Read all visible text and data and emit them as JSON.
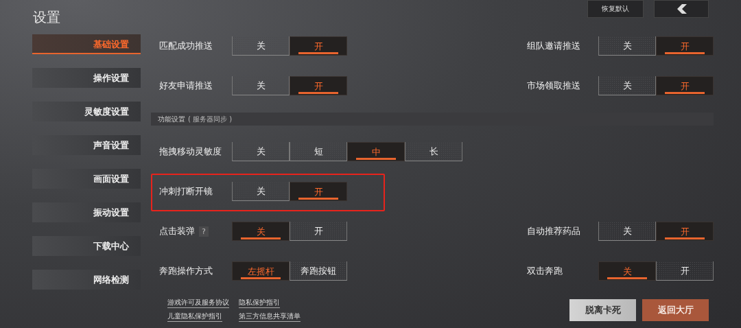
{
  "title": "设置",
  "restore_button": "恢复默认",
  "sidebar": [
    {
      "label": "基础设置",
      "selected": true
    },
    {
      "label": "操作设置",
      "selected": false
    },
    {
      "label": "灵敏度设置",
      "selected": false
    },
    {
      "label": "声音设置",
      "selected": false
    },
    {
      "label": "画面设置",
      "selected": false
    },
    {
      "label": "振动设置",
      "selected": false
    },
    {
      "label": "下载中心",
      "selected": false
    },
    {
      "label": "网络检测",
      "selected": false
    }
  ],
  "settings": [
    {
      "kind": "row",
      "left": {
        "label": "匹配成功推送",
        "options": [
          {
            "label": "关",
            "selected": false
          },
          {
            "label": "开",
            "selected": true
          }
        ]
      },
      "right": {
        "label": "组队邀请推送",
        "options": [
          {
            "label": "关",
            "selected": false
          },
          {
            "label": "开",
            "selected": true
          }
        ]
      }
    },
    {
      "kind": "row",
      "left": {
        "label": "好友申请推送",
        "options": [
          {
            "label": "关",
            "selected": false
          },
          {
            "label": "开",
            "selected": true
          }
        ]
      },
      "right": {
        "label": "市场领取推送",
        "options": [
          {
            "label": "关",
            "selected": false
          },
          {
            "label": "开",
            "selected": true
          }
        ]
      }
    },
    {
      "kind": "header",
      "label": "功能设置",
      "note": "( 服务器同步 )"
    },
    {
      "kind": "row",
      "left": {
        "label": "拖拽移动灵敏度",
        "options": [
          {
            "label": "关",
            "selected": false
          },
          {
            "label": "短",
            "selected": false
          },
          {
            "label": "中",
            "selected": true
          },
          {
            "label": "长",
            "selected": false
          }
        ]
      }
    },
    {
      "kind": "row",
      "highlighted": true,
      "left": {
        "label": "冲刺打断开镜",
        "options": [
          {
            "label": "关",
            "selected": false
          },
          {
            "label": "开",
            "selected": true
          }
        ]
      }
    },
    {
      "kind": "row",
      "left": {
        "label": "点击装弹",
        "help": "?",
        "options": [
          {
            "label": "关",
            "selected": true
          },
          {
            "label": "开",
            "selected": false
          }
        ]
      },
      "right": {
        "label": "自动推荐药品",
        "options": [
          {
            "label": "关",
            "selected": false
          },
          {
            "label": "开",
            "selected": true
          }
        ]
      }
    },
    {
      "kind": "row",
      "left": {
        "label": "奔跑操作方式",
        "options": [
          {
            "label": "左摇杆",
            "selected": true
          },
          {
            "label": "奔跑按钮",
            "selected": false
          }
        ]
      },
      "right": {
        "label": "双击奔跑",
        "options": [
          {
            "label": "关",
            "selected": true
          },
          {
            "label": "开",
            "selected": false
          }
        ]
      }
    }
  ],
  "links": [
    "游戏许可及服务协议",
    "隐私保护指引",
    "儿童隐私保护指引",
    "第三方信息共享清单"
  ],
  "buttons": [
    {
      "label": "脱离卡死",
      "kind": "secondary"
    },
    {
      "label": "返回大厅",
      "kind": "primary"
    }
  ]
}
